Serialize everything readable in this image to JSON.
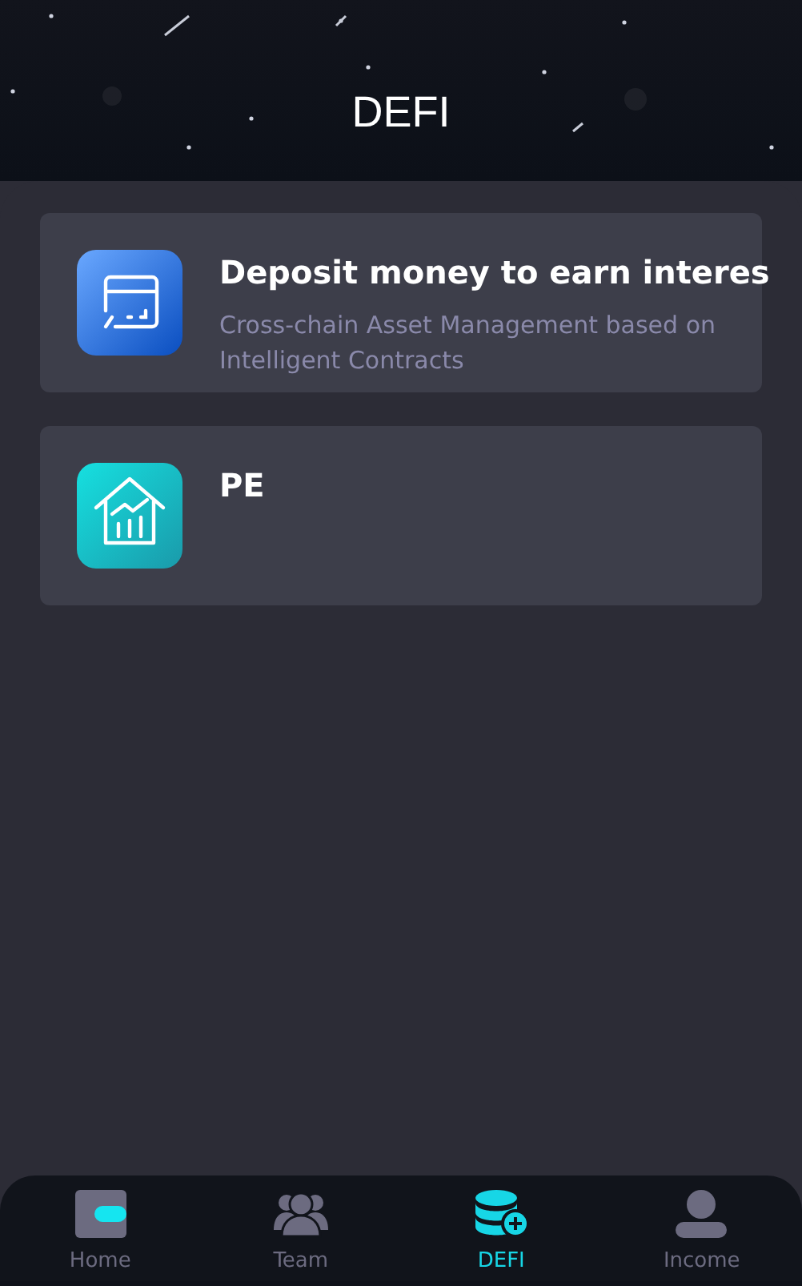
{
  "header": {
    "title": "DEFI"
  },
  "cards": [
    {
      "kind": "card",
      "title": "Deposit money to earn interes",
      "subtitle": "Cross-chain Asset Management based on Intelligent Contracts"
    },
    {
      "kind": "house",
      "title": "PE"
    }
  ],
  "nav": [
    {
      "kind": "wallet",
      "label": "Home",
      "selected": false
    },
    {
      "kind": "team",
      "label": "Team",
      "selected": false
    },
    {
      "kind": "coins",
      "label": "DEFI",
      "selected": true
    },
    {
      "kind": "person",
      "label": "Income",
      "selected": false
    }
  ]
}
